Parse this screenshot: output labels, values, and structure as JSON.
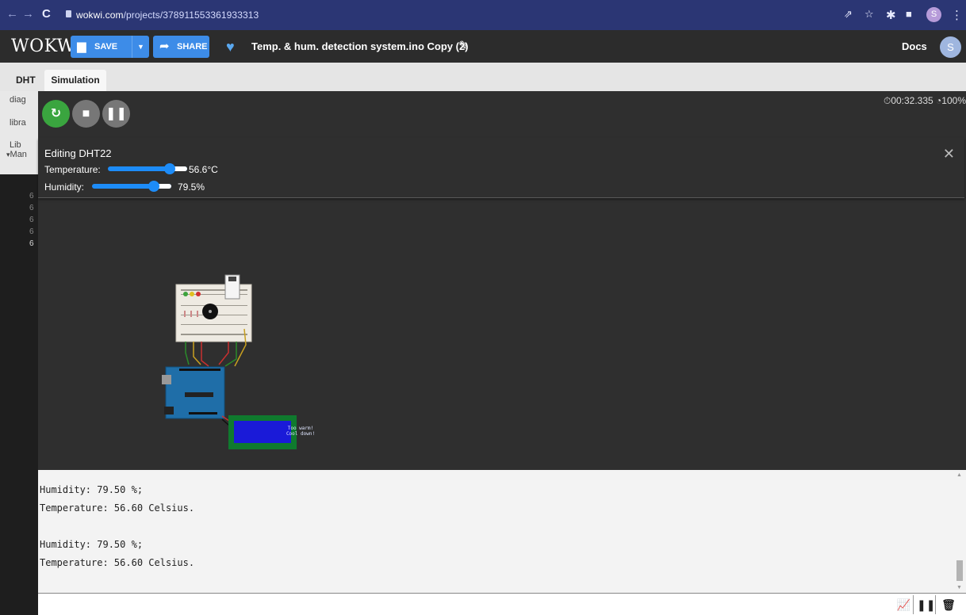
{
  "browser": {
    "url_host": "wokwi.com",
    "url_path": "/projects/378911553361933313",
    "back_icon": "arrow-left-icon",
    "forward_icon": "arrow-right-icon",
    "reload_icon": "reload-icon",
    "profile_initial": "S"
  },
  "header": {
    "logo": "WOKWi",
    "save_label": "SAVE",
    "share_label": "SHARE",
    "project_title": "Temp. & hum. detection system.ino Copy (2)",
    "docs_label": "Docs",
    "avatar_initial": "S"
  },
  "tabs": {
    "file_tab": "DHT",
    "sim_tab": "Simulation"
  },
  "left_panel": {
    "items": [
      "diag",
      "libra",
      "Lib",
      "Man"
    ],
    "line_numbers": [
      "6",
      "6",
      "6",
      "6",
      "6"
    ]
  },
  "simulation": {
    "timer": "00:32.335",
    "speed": "100%"
  },
  "editor_panel": {
    "title": "Editing DHT22",
    "temperature_label": "Temperature:",
    "temperature_value": "56.6°C",
    "temperature_fraction": 0.78,
    "humidity_label": "Humidity:",
    "humidity_value": "79.5%",
    "humidity_fraction": 0.78
  },
  "lcd": {
    "line1": "Too warm!",
    "line2": "Cool down!"
  },
  "serial": {
    "lines": [
      "Humidity: 79.50 %;",
      "Temperature: 56.60 Celsius.",
      "",
      "Humidity: 79.50 %;",
      "Temperature: 56.60 Celsius."
    ]
  },
  "colors": {
    "accent": "#3d8ce8",
    "play": "#3aa53f",
    "slider": "#1d8cf8"
  }
}
